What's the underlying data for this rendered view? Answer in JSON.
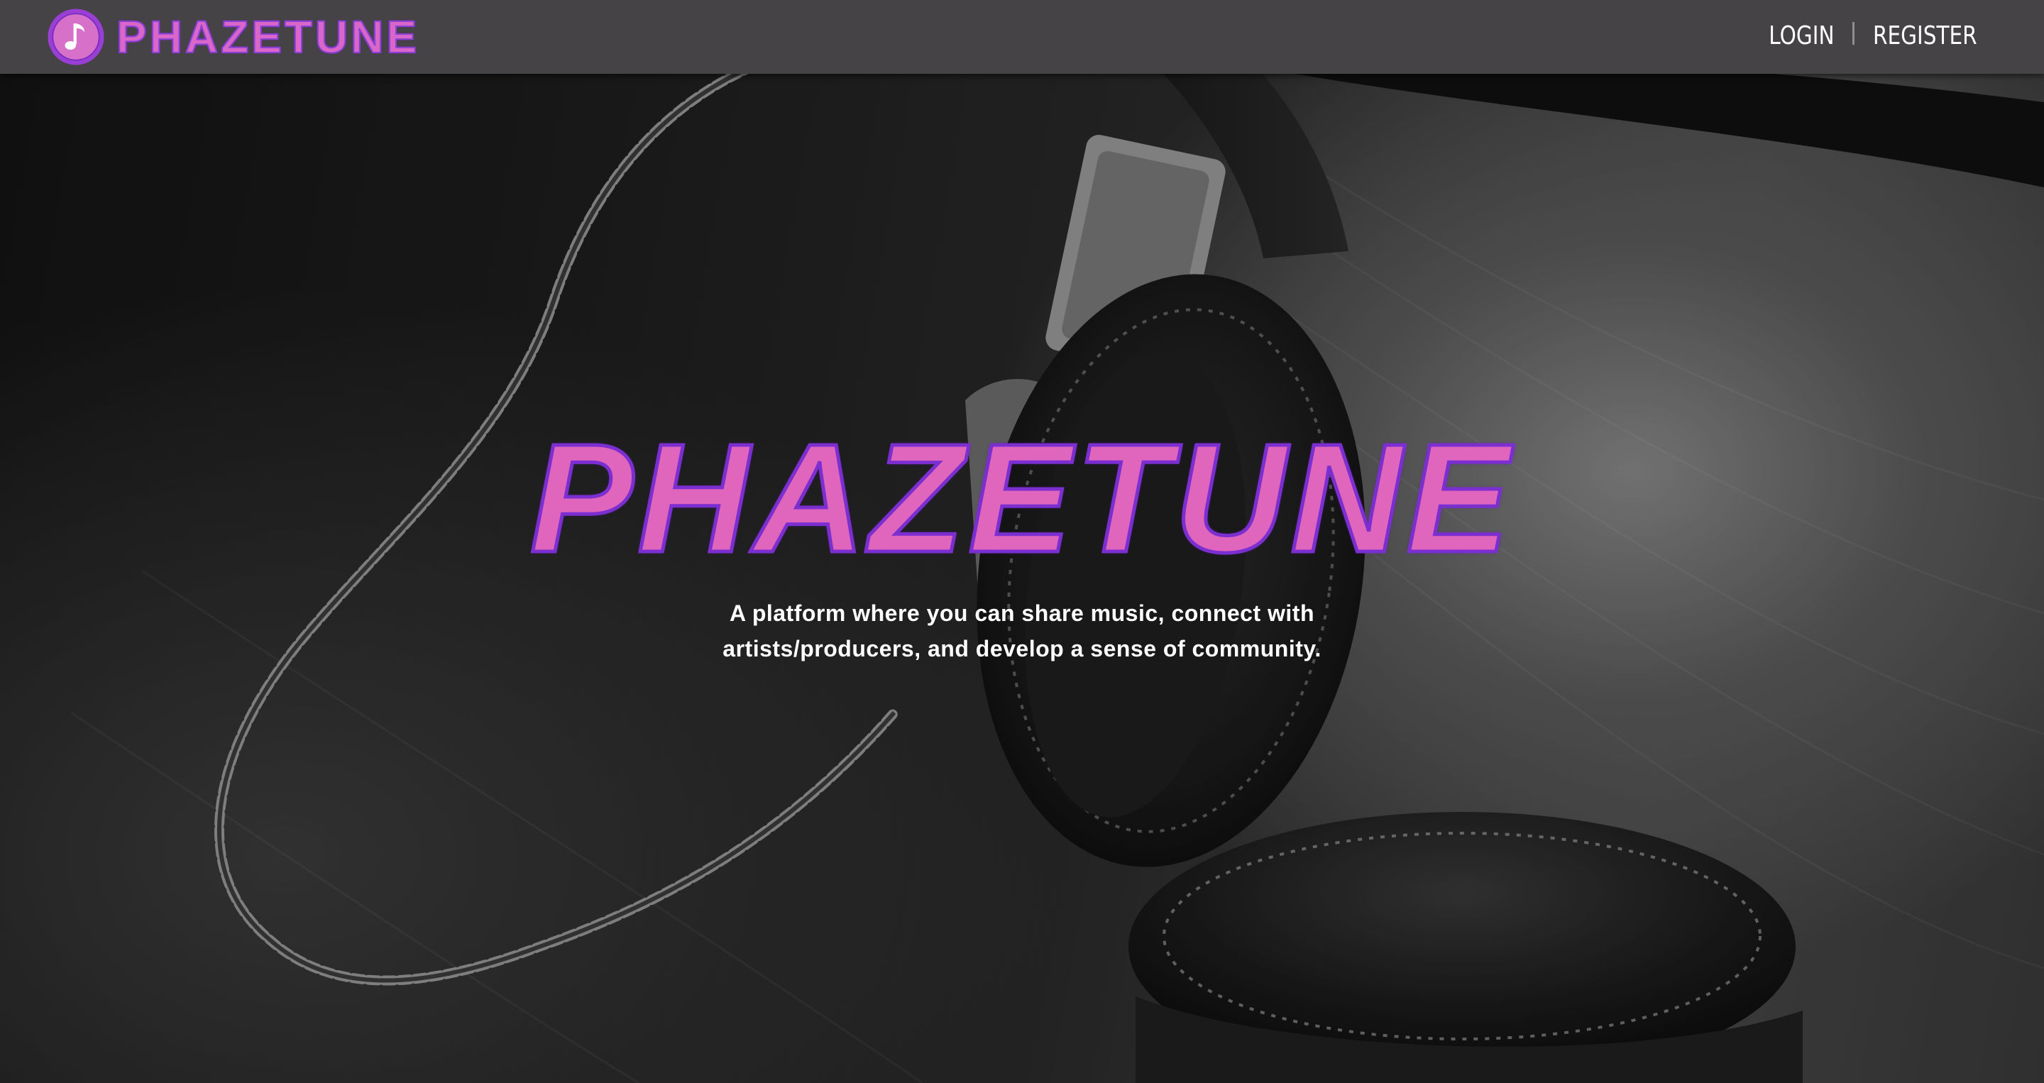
{
  "brand": {
    "name": "PHAZETUNE",
    "logo_icon": "music-note-icon",
    "color": "#d966c9",
    "outline_color": "#8c3fd6"
  },
  "nav": {
    "login_label": "LOGIN",
    "register_label": "REGISTER",
    "background": "#454345"
  },
  "hero": {
    "title": "PHAZETUNE",
    "subtitle": "A platform where you can share music, connect with artists/producers, and develop a sense of community.",
    "title_color": "#e066bd",
    "title_outline_color": "#7b2fd0",
    "background_image": "headphones-photo"
  }
}
